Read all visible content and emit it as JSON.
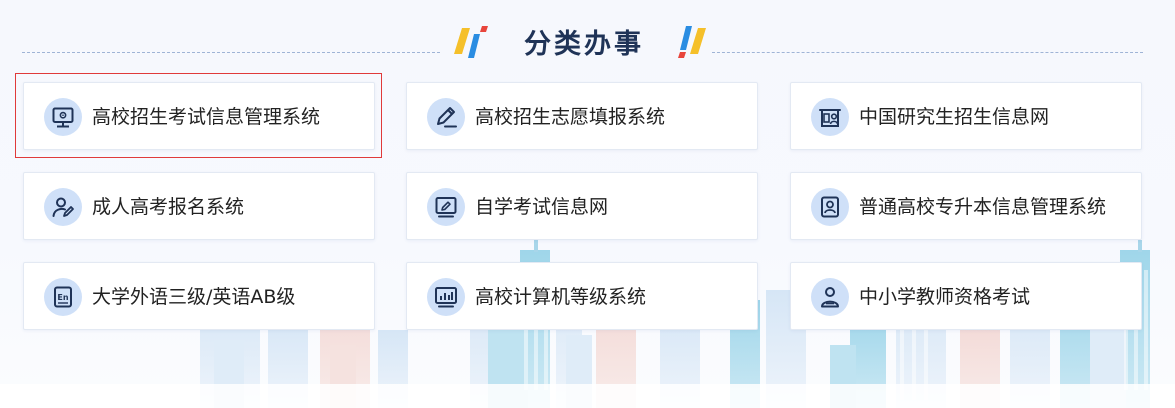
{
  "section": {
    "title": "分类办事"
  },
  "services": [
    {
      "label": "高校招生考试信息管理系统",
      "icon": "monitor-gear-icon"
    },
    {
      "label": "高校招生志愿填报系统",
      "icon": "pencil-icon"
    },
    {
      "label": "中国研究生招生信息网",
      "icon": "graduate-id-icon"
    },
    {
      "label": "成人高考报名系统",
      "icon": "user-edit-icon"
    },
    {
      "label": "自学考试信息网",
      "icon": "screen-pen-icon"
    },
    {
      "label": "普通高校专升本信息管理系统",
      "icon": "person-card-icon"
    },
    {
      "label": "大学外语三级/英语AB级",
      "icon": "english-doc-icon"
    },
    {
      "label": "高校计算机等级系统",
      "icon": "computer-chart-icon"
    },
    {
      "label": "中小学教师资格考试",
      "icon": "teacher-icon"
    }
  ],
  "colors": {
    "title": "#1f3357",
    "icon_circle": "#cfe0f8",
    "icon_stroke": "#1f3357",
    "highlight": "#e03a3a",
    "deco_blue": "#2a8de2",
    "deco_yellow": "#f5c02a",
    "deco_red": "#e8453c"
  }
}
